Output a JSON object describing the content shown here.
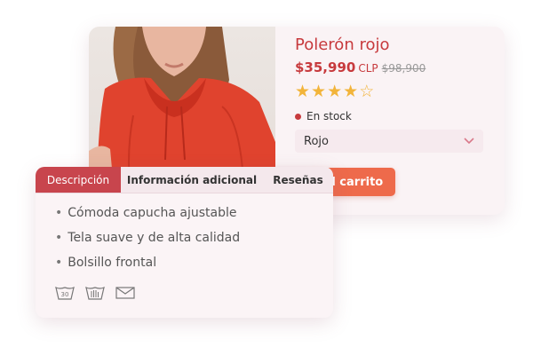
{
  "product": {
    "title": "Polerón rojo",
    "price": "$35,990",
    "currency": "CLP",
    "old_price": "$98,900",
    "rating": 4,
    "rating_max": 5,
    "stock_text": "En stock",
    "color_select": "Rojo",
    "add_to_cart": "Añadir al carrito",
    "colors": {
      "accent": "#c73a3d",
      "button": "#ee6a4b",
      "star": "#f2b43a"
    }
  },
  "tabs": [
    {
      "label": "Descripción",
      "active": true
    },
    {
      "label": "Información adicional",
      "active": false
    },
    {
      "label": "Reseñas",
      "active": false
    }
  ],
  "features": [
    "Cómoda capucha ajustable",
    "Tela suave y de alta calidad",
    "Bolsillo frontal"
  ],
  "care_icons": [
    "wash-30-icon",
    "hand-wash-icon",
    "envelope-icon"
  ],
  "care_icon_label": "30"
}
